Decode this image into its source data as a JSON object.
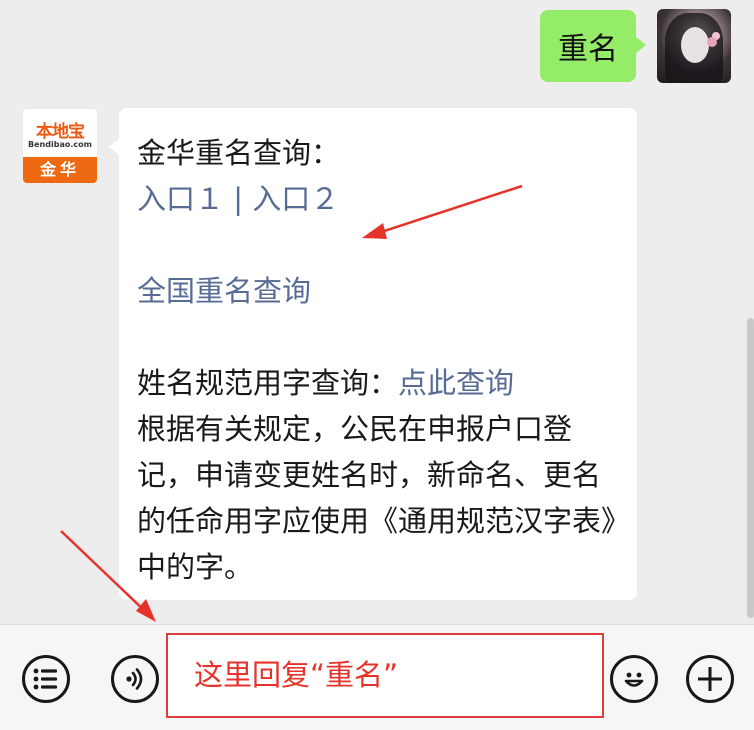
{
  "conversation": {
    "user_message": "重名",
    "reply": {
      "heading": "金华重名查询：",
      "entry1": "入口１",
      "separator": " | ",
      "entry2": "入口２",
      "national_link": "全国重名查询",
      "std_label": "姓名规范用字查询：",
      "std_link": "点此查询",
      "paragraph": "根据有关规定，公民在申报户口登记，申请变更姓名时，新命名、更名的任命用字应使用《通用规范汉字表》中的字。"
    }
  },
  "official_account": {
    "brand": "本地宝",
    "domain": "Bendibao.com",
    "city": "金华"
  },
  "input": {
    "hint": "这里回复“重名”"
  },
  "toolbar": {
    "menu_icon": "menu-list-icon",
    "voice_icon": "voice-icon",
    "emoji_icon": "emoji-icon",
    "plus_icon": "plus-icon"
  },
  "colors": {
    "link": "#576b95",
    "user_bubble": "#95ec69",
    "annotation_red": "#e5332a",
    "brand_orange": "#ed6a12"
  }
}
